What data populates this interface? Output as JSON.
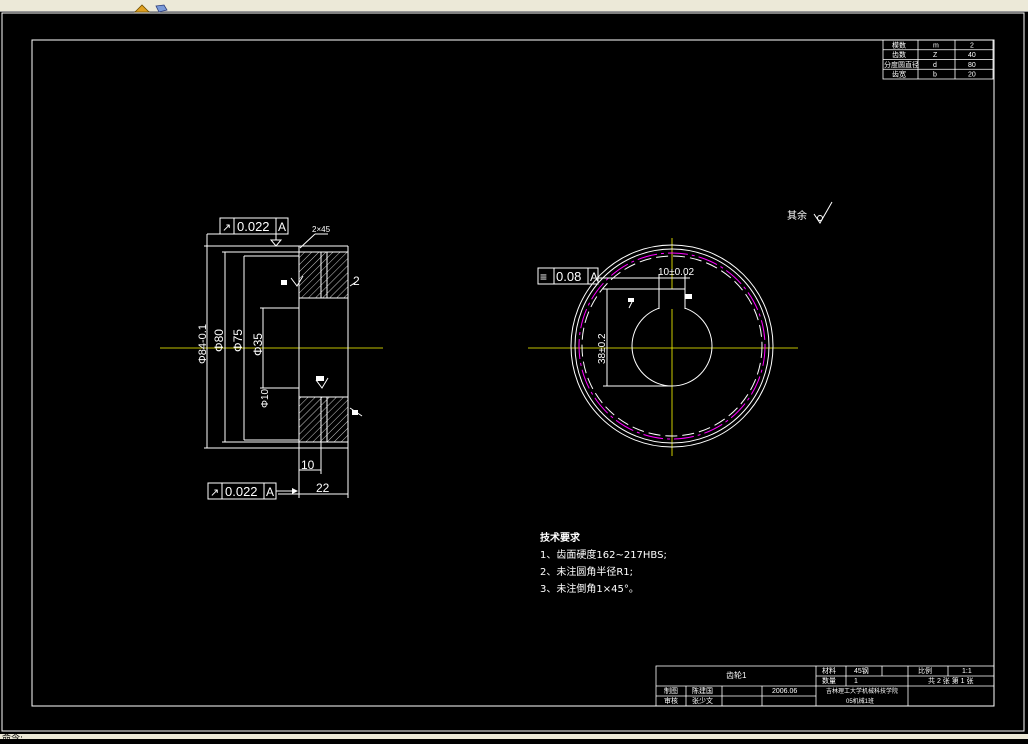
{
  "ui": {
    "status_text": "命令:",
    "colors": {
      "background": "#000000",
      "line": "#ffffff",
      "center_line": "#ffff00",
      "pitch_circle": "#ff00ff",
      "toolbar": "#ece9d8"
    }
  },
  "left_view": {
    "tolerance_top": {
      "symbol": "↗",
      "value": "0.022",
      "datum": "A"
    },
    "tolerance_bottom": {
      "symbol": "↗",
      "value": "0.022",
      "datum": "A"
    },
    "chamfer": "2×45",
    "dim_outer": "Φ84-0.1",
    "dim_80": "Φ80",
    "dim_75": "Φ75",
    "dim_35": "Φ35",
    "dim_small": "Φ10",
    "dim_2": "2",
    "dim_10": "10",
    "dim_22": "22"
  },
  "right_view": {
    "tolerance": {
      "symbol": "≡",
      "value": "0.08",
      "datum": "A"
    },
    "keyway_width": "10±0.02",
    "keyway_depth": "38±0.2",
    "other_roughness": "其余"
  },
  "notes": {
    "title": "技术要求",
    "items": [
      "1、齿面硬度162~217HBS;",
      "2、未注圆角半径R1;",
      "3、未注倒角1×45°。"
    ]
  },
  "param_table": {
    "rows": [
      [
        "模数",
        "m",
        "2"
      ],
      [
        "齿数",
        "Z",
        "40"
      ],
      [
        "分度圆直径",
        "d",
        "80"
      ],
      [
        "齿宽",
        "b",
        "20"
      ]
    ]
  },
  "title_block": {
    "drawing_name": "齿轮1",
    "material_label": "材料",
    "material": "45钢",
    "scale_label": "比例",
    "scale": "1:1",
    "qty_label": "数量",
    "qty": "1",
    "sheet": "共 2 张 第 1 张",
    "designer_label": "制图",
    "designer": "陈建国",
    "date": "2006.06",
    "checker_label": "审核",
    "checker": "张少文",
    "school": "吉林理工大学机械科技学院",
    "class": "05机械1班"
  }
}
